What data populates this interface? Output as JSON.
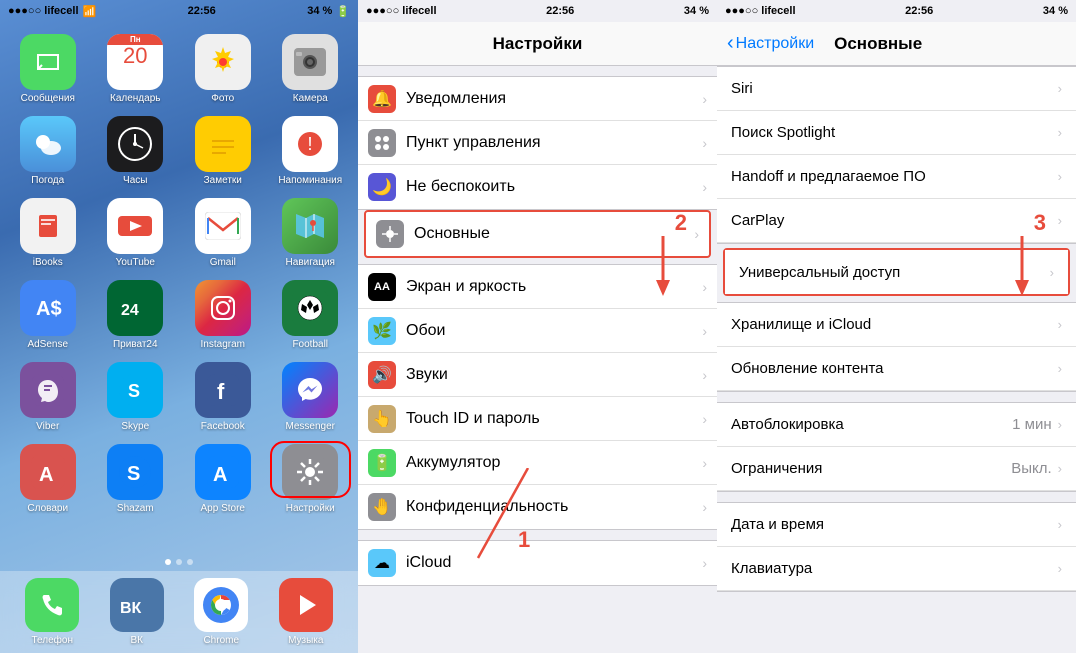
{
  "phone1": {
    "status": {
      "carrier": "●●●○○ lifecell",
      "wifi": "▲",
      "time": "22:56",
      "battery": "34 %"
    },
    "apps": [
      {
        "id": "messages",
        "label": "Сообщения",
        "icon": "💬",
        "bg": "#4cd964"
      },
      {
        "id": "calendar",
        "label": "Календарь",
        "icon": "📅",
        "bg": "#fff"
      },
      {
        "id": "photos",
        "label": "Фото",
        "icon": "🌸",
        "bg": "#f0f0f0"
      },
      {
        "id": "camera",
        "label": "Камера",
        "icon": "📷",
        "bg": "#ccc"
      },
      {
        "id": "weather",
        "label": "Погода",
        "icon": "☁️",
        "bg": "#5ac8fa"
      },
      {
        "id": "clock",
        "label": "Часы",
        "icon": "🕐",
        "bg": "#1c1c1e"
      },
      {
        "id": "notes",
        "label": "Заметки",
        "icon": "📝",
        "bg": "#ffcc02"
      },
      {
        "id": "reminders",
        "label": "Напоминания",
        "icon": "🔔",
        "bg": "#fff"
      },
      {
        "id": "ibooks",
        "label": "iBooks",
        "icon": "📚",
        "bg": "#f2f2f2"
      },
      {
        "id": "youtube",
        "label": "YouTube",
        "icon": "▶",
        "bg": "#fff"
      },
      {
        "id": "gmail",
        "label": "Gmail",
        "icon": "M",
        "bg": "#fff"
      },
      {
        "id": "maps",
        "label": "Навигация",
        "icon": "🗺",
        "bg": "#60c659"
      },
      {
        "id": "adsense",
        "label": "AdSense",
        "icon": "A$",
        "bg": "#4285f4"
      },
      {
        "id": "privat",
        "label": "Приват24",
        "icon": "24",
        "bg": "#006633"
      },
      {
        "id": "instagram",
        "label": "Instagram",
        "icon": "📷",
        "bg": "#e1306c"
      },
      {
        "id": "football",
        "label": "Football",
        "icon": "⚽",
        "bg": "#1a7c3e"
      },
      {
        "id": "viber",
        "label": "Viber",
        "icon": "📞",
        "bg": "#7b519d"
      },
      {
        "id": "skype",
        "label": "Skype",
        "icon": "S",
        "bg": "#00aff0"
      },
      {
        "id": "facebook",
        "label": "Facebook",
        "icon": "f",
        "bg": "#3b5998"
      },
      {
        "id": "messenger",
        "label": "Messenger",
        "icon": "💬",
        "bg": "#0084ff"
      },
      {
        "id": "slovari",
        "label": "Словари",
        "icon": "А",
        "bg": "#d9534f"
      },
      {
        "id": "shazam",
        "label": "Shazam",
        "icon": "S",
        "bg": "#0d7ff5"
      },
      {
        "id": "appstore",
        "label": "App Store",
        "icon": "A",
        "bg": "#0d84ff"
      },
      {
        "id": "settings",
        "label": "Настройки",
        "icon": "⚙",
        "bg": "#8e8e93",
        "highlighted": true
      }
    ],
    "dock": [
      {
        "id": "phone",
        "label": "Телефон",
        "icon": "📞",
        "bg": "#4cd964"
      },
      {
        "id": "vk",
        "label": "ВК",
        "icon": "VK",
        "bg": "#4a76a8"
      },
      {
        "id": "chrome",
        "label": "Chrome",
        "icon": "●",
        "bg": "#fff"
      },
      {
        "id": "music",
        "label": "Музыка",
        "icon": "▶",
        "bg": "#e74c3c"
      }
    ]
  },
  "phone2": {
    "status": {
      "carrier": "●●●○○ lifecell",
      "wifi": "▲",
      "time": "22:56",
      "battery": "34 %"
    },
    "title": "Настройки",
    "sections": [
      {
        "rows": [
          {
            "id": "notifications",
            "icon": "🔔",
            "iconBg": "#e74c3c",
            "label": "Уведомления"
          },
          {
            "id": "controlcenter",
            "icon": "⊞",
            "iconBg": "#8e8e93",
            "label": "Пункт управления"
          },
          {
            "id": "dnd",
            "icon": "🌙",
            "iconBg": "#5856d6",
            "label": "Не беспокоить"
          }
        ]
      },
      {
        "highlighted": true,
        "rows": [
          {
            "id": "general",
            "icon": "⚙",
            "iconBg": "#8e8e93",
            "label": "Основные",
            "highlighted": true
          }
        ]
      },
      {
        "rows": [
          {
            "id": "display",
            "icon": "AA",
            "iconBg": "#000",
            "label": "Экран и яркость"
          },
          {
            "id": "wallpaper",
            "icon": "🌿",
            "iconBg": "#5ac8fa",
            "label": "Обои"
          },
          {
            "id": "sounds",
            "icon": "🔊",
            "iconBg": "#e74c3c",
            "label": "Звуки"
          },
          {
            "id": "touchid",
            "icon": "👆",
            "iconBg": "#c8a96e",
            "label": "Touch ID и пароль"
          },
          {
            "id": "battery",
            "icon": "🔋",
            "iconBg": "#4cd964",
            "label": "Аккумулятор"
          },
          {
            "id": "privacy",
            "icon": "🤚",
            "iconBg": "#8e8e93",
            "label": "Конфиденциальность"
          }
        ]
      },
      {
        "rows": [
          {
            "id": "icloud",
            "icon": "☁",
            "iconBg": "#5ac8fa",
            "label": "iCloud"
          }
        ]
      }
    ],
    "arrow2": {
      "label": "2",
      "note": "arrow down to Основные"
    }
  },
  "phone3": {
    "status": {
      "carrier": "●●●○○ lifecell",
      "wifi": "▲",
      "time": "22:56",
      "battery": "34 %"
    },
    "backLabel": "Настройки",
    "title": "Основные",
    "rows": [
      {
        "id": "siri",
        "label": "Siri",
        "group": 1
      },
      {
        "id": "spotlight",
        "label": "Поиск Spotlight",
        "group": 1
      },
      {
        "id": "handoff",
        "label": "Handoff и предлагаемое ПО",
        "group": 1
      },
      {
        "id": "carplay",
        "label": "CarPlay",
        "group": 1
      },
      {
        "id": "accessibility",
        "label": "Универсальный доступ",
        "group": 2,
        "highlighted": true
      },
      {
        "id": "storage",
        "label": "Хранилище и iCloud",
        "group": 3
      },
      {
        "id": "bgrefresh",
        "label": "Обновление контента",
        "group": 3
      },
      {
        "id": "autolock",
        "label": "Автоблокировка",
        "value": "1 мин",
        "group": 4
      },
      {
        "id": "restrictions",
        "label": "Ограничения",
        "value": "Выкл.",
        "group": 4
      },
      {
        "id": "datetime",
        "label": "Дата и время",
        "group": 5
      },
      {
        "id": "keyboard",
        "label": "Клавиатура",
        "group": 5
      }
    ],
    "arrow3": {
      "label": "3",
      "note": "arrow down to Универсальный доступ"
    }
  }
}
